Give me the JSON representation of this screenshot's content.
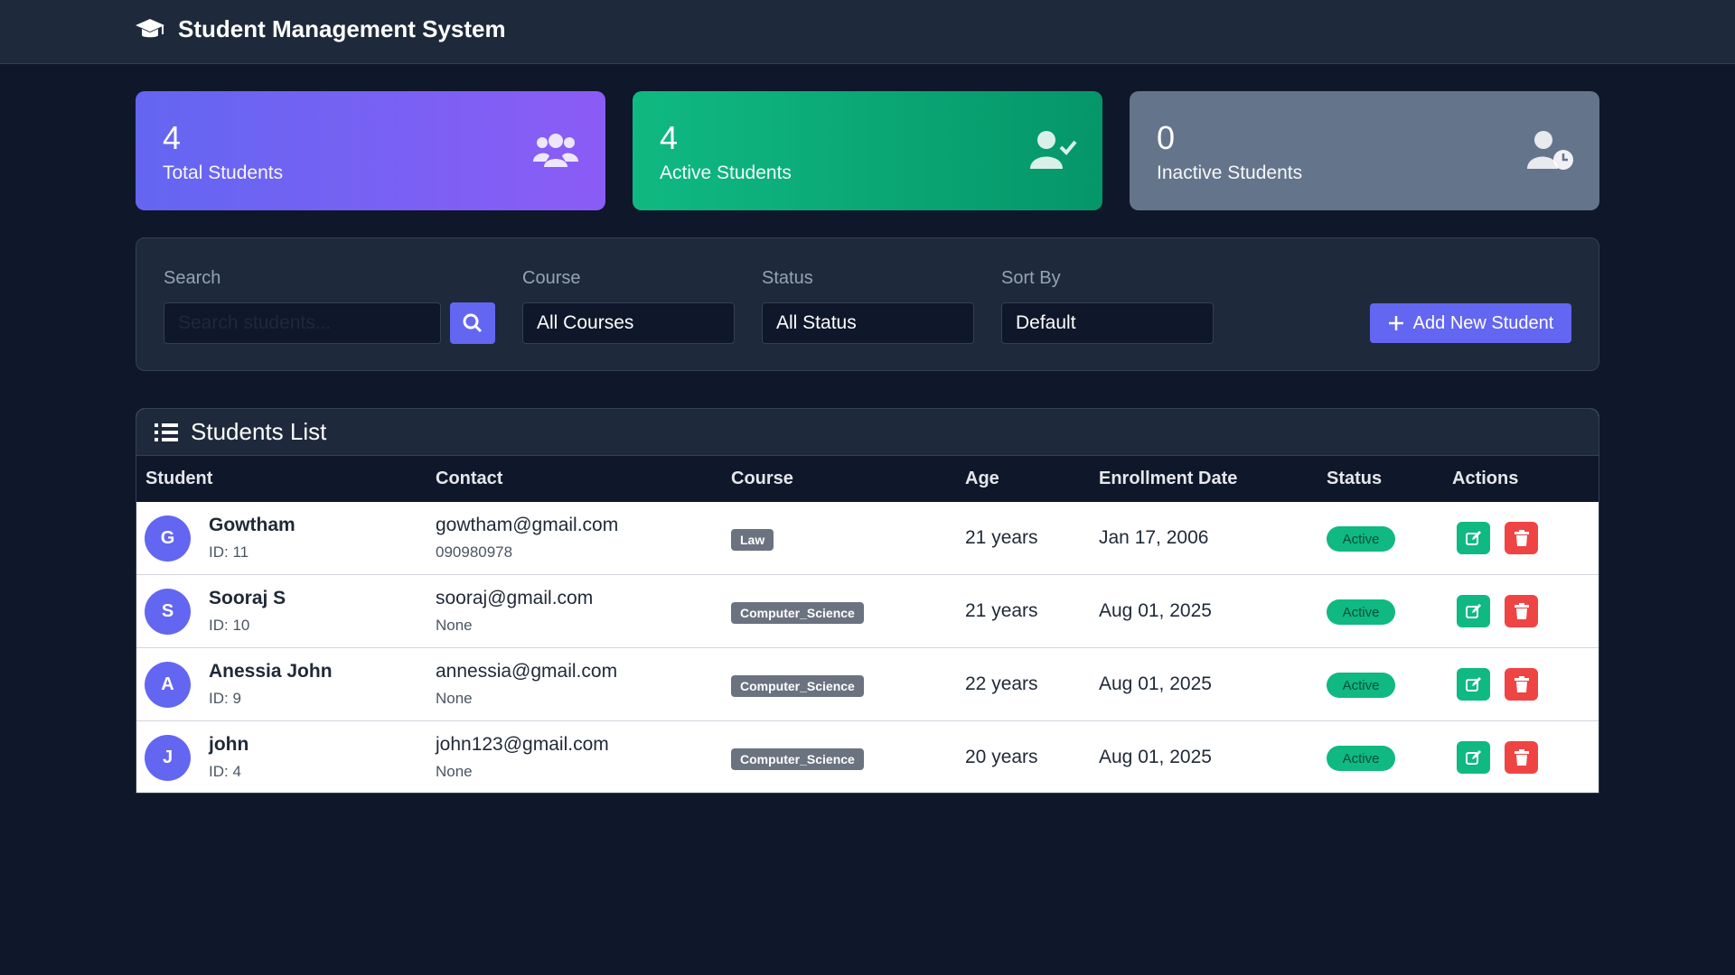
{
  "app": {
    "title": "Student Management System"
  },
  "stats": [
    {
      "value": "4",
      "label": "Total Students",
      "icon": "users-icon"
    },
    {
      "value": "4",
      "label": "Active Students",
      "icon": "user-check-icon"
    },
    {
      "value": "0",
      "label": "Inactive Students",
      "icon": "user-clock-icon"
    }
  ],
  "filters": {
    "search_label": "Search",
    "search_placeholder": "Search students...",
    "course_label": "Course",
    "course_value": "All Courses",
    "status_label": "Status",
    "status_value": "All Status",
    "sort_label": "Sort By",
    "sort_value": "Default",
    "add_button": "Add New Student"
  },
  "list": {
    "title": "Students List",
    "columns": [
      "Student",
      "Contact",
      "Course",
      "Age",
      "Enrollment Date",
      "Status",
      "Actions"
    ],
    "rows": [
      {
        "initial": "G",
        "name": "Gowtham",
        "id": "ID: 11",
        "email": "gowtham@gmail.com",
        "phone": "090980978",
        "course": "Law",
        "age": "21 years",
        "enrolled": "Jan 17, 2006",
        "status": "Active"
      },
      {
        "initial": "S",
        "name": "Sooraj S",
        "id": "ID: 10",
        "email": "sooraj@gmail.com",
        "phone": "None",
        "course": "Computer_Science",
        "age": "21 years",
        "enrolled": "Aug 01, 2025",
        "status": "Active"
      },
      {
        "initial": "A",
        "name": "Anessia John",
        "id": "ID: 9",
        "email": "annessia@gmail.com",
        "phone": "None",
        "course": "Computer_Science",
        "age": "22 years",
        "enrolled": "Aug 01, 2025",
        "status": "Active"
      },
      {
        "initial": "J",
        "name": "john",
        "id": "ID: 4",
        "email": "john123@gmail.com",
        "phone": "None",
        "course": "Computer_Science",
        "age": "20 years",
        "enrolled": "Aug 01, 2025",
        "status": "Active"
      }
    ]
  },
  "colors": {
    "background": "#0f172a",
    "panel": "#1e293b",
    "accent": "#6366f1",
    "success": "#10b981",
    "danger": "#ef4444",
    "muted": "#64748b"
  }
}
